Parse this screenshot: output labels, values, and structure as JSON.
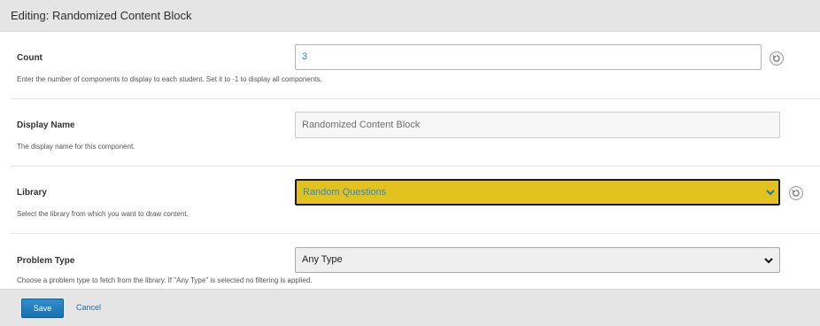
{
  "header": {
    "title": "Editing: Randomized Content Block"
  },
  "fields": {
    "count": {
      "label": "Count",
      "value": "3",
      "help": "Enter the number of components to display to each student. Set it to -1 to display all components."
    },
    "display_name": {
      "label": "Display Name",
      "value": "Randomized Content Block",
      "help": "The display name for this component."
    },
    "library": {
      "label": "Library",
      "selected": "Random Questions",
      "help": "Select the library from which you want to draw content."
    },
    "problem_type": {
      "label": "Problem Type",
      "selected": "Any Type",
      "help": "Choose a problem type to fetch from the library. If \"Any Type\" is selected no filtering is applied."
    }
  },
  "footer": {
    "save_label": "Save",
    "cancel_label": "Cancel"
  },
  "icons": {
    "reset": "reset-icon",
    "dropdown": "chevron-down-icon"
  },
  "colors": {
    "header_bg": "#e5e5e5",
    "library_highlight": "#e3c220",
    "accent_blue": "#2c8ccd",
    "save_button": "#1a6fae"
  }
}
